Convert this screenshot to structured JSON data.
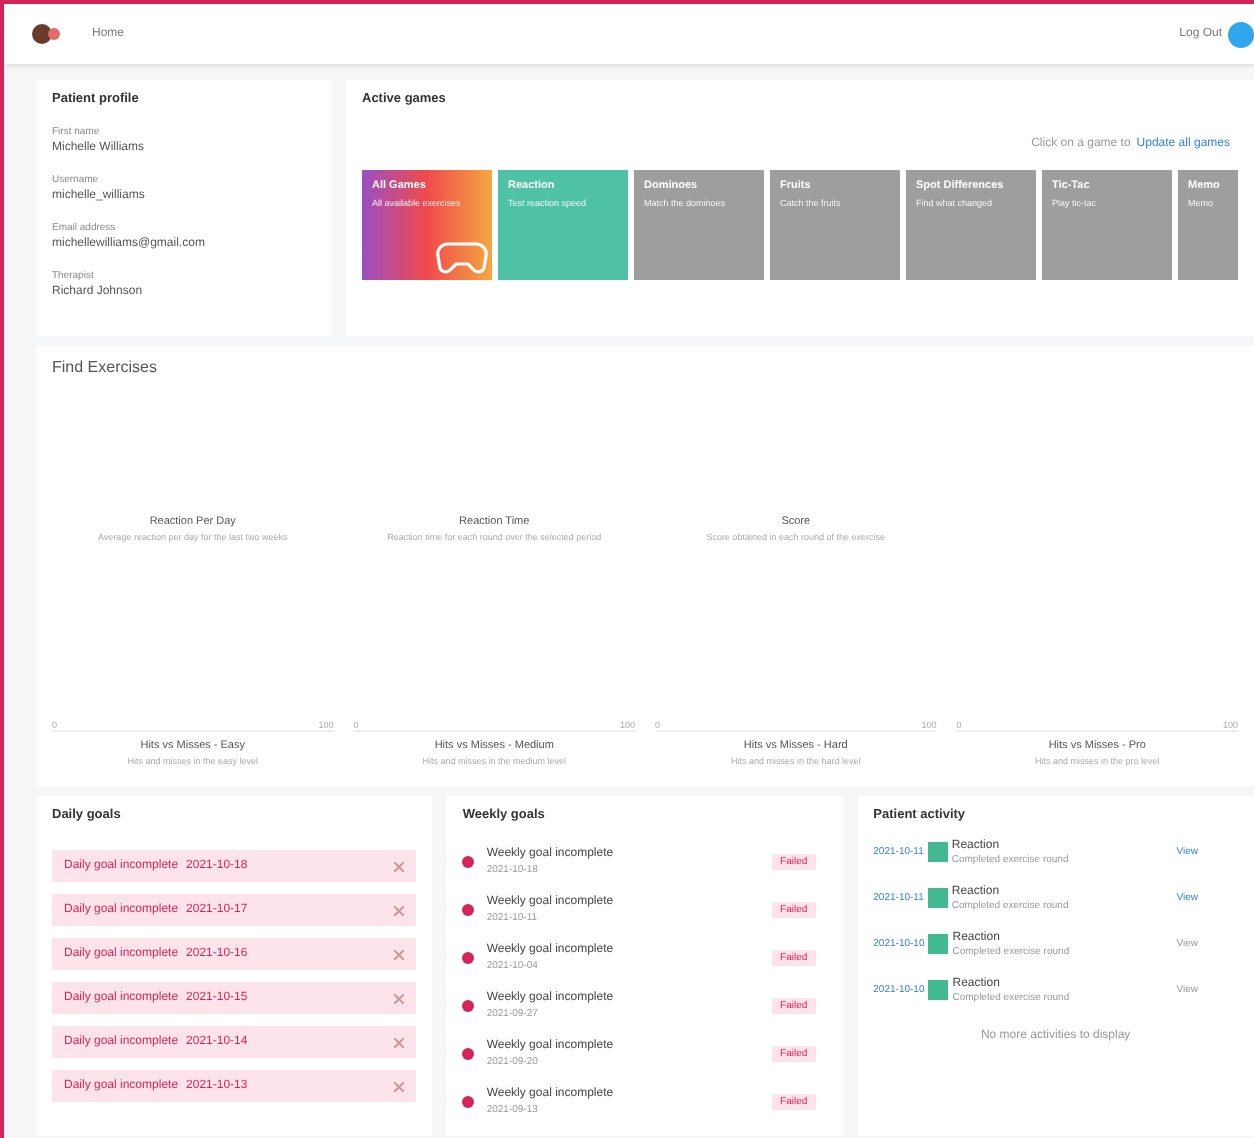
{
  "topbar": {
    "nav_link": "Home",
    "user_name": "Log Out"
  },
  "profile": {
    "title": "Patient profile",
    "fields": [
      {
        "label": "First name",
        "value": "Michelle Williams"
      },
      {
        "label": "Username",
        "value": "michelle_williams"
      },
      {
        "label": "Email address",
        "value": "michellewilliams@gmail.com"
      },
      {
        "label": "Therapist",
        "value": "Richard Johnson"
      }
    ]
  },
  "games": {
    "title": "Active games",
    "hint": "Click on a game to",
    "link": "Update all games",
    "tiles": [
      {
        "title": "All Games",
        "subtitle": "All available exercises",
        "kind": "gradient",
        "color": "#f04a4a"
      },
      {
        "title": "Reaction",
        "subtitle": "Test reaction speed",
        "kind": "solid",
        "color": "#4fc2a6"
      },
      {
        "title": "Dominoes",
        "subtitle": "Match the dominoes",
        "kind": "solid",
        "color": "#9e9e9e"
      },
      {
        "title": "Fruits",
        "subtitle": "Catch the fruits",
        "kind": "solid",
        "color": "#9e9e9e"
      },
      {
        "title": "Spot Differences",
        "subtitle": "Find what changed",
        "kind": "solid",
        "color": "#9e9e9e"
      },
      {
        "title": "Tic-Tac",
        "subtitle": "Play tic-tac",
        "kind": "solid",
        "color": "#9e9e9e"
      },
      {
        "title": "Memo",
        "subtitle": "Memo",
        "kind": "solid",
        "color": "#9e9e9e"
      }
    ]
  },
  "exercises": {
    "title": "Find Exercises",
    "charts": [
      {
        "title": "Reaction Per Day",
        "subtitle": "Average reaction per day for the last two weeks"
      },
      {
        "title": "Reaction Time",
        "subtitle": "Reaction time for each round over the selected period"
      },
      {
        "title": "Score",
        "subtitle": "Score obtained in each round of the exercise"
      }
    ],
    "hit_charts": [
      {
        "title": "Hits vs Misses - Easy",
        "subtitle": "Hits and misses in the easy level",
        "ticks": [
          "0",
          "100"
        ]
      },
      {
        "title": "Hits vs Misses - Medium",
        "subtitle": "Hits and misses in the medium level",
        "ticks": [
          "0",
          "100"
        ]
      },
      {
        "title": "Hits vs Misses - Hard",
        "subtitle": "Hits and misses in the hard level",
        "ticks": [
          "0",
          "100"
        ]
      },
      {
        "title": "Hits vs Misses - Pro",
        "subtitle": "Hits and misses in the pro level",
        "ticks": [
          "0",
          "100"
        ]
      }
    ]
  },
  "daily_goals": {
    "title": "Daily goals",
    "items": [
      {
        "text": "Daily goal incomplete",
        "date": "2021-10-18"
      },
      {
        "text": "Daily goal incomplete",
        "date": "2021-10-17"
      },
      {
        "text": "Daily goal incomplete",
        "date": "2021-10-16"
      },
      {
        "text": "Daily goal incomplete",
        "date": "2021-10-15"
      },
      {
        "text": "Daily goal incomplete",
        "date": "2021-10-14"
      },
      {
        "text": "Daily goal incomplete",
        "date": "2021-10-13"
      }
    ]
  },
  "weekly_goals": {
    "title": "Weekly goals",
    "items": [
      {
        "text": "Weekly goal incomplete",
        "date": "2021-10-18",
        "badge": "Failed"
      },
      {
        "text": "Weekly goal incomplete",
        "date": "2021-10-11",
        "badge": "Failed"
      },
      {
        "text": "Weekly goal incomplete",
        "date": "2021-10-04",
        "badge": "Failed"
      },
      {
        "text": "Weekly goal incomplete",
        "date": "2021-09-27",
        "badge": "Failed"
      },
      {
        "text": "Weekly goal incomplete",
        "date": "2021-09-20",
        "badge": "Failed"
      },
      {
        "text": "Weekly goal incomplete",
        "date": "2021-09-13",
        "badge": "Failed"
      }
    ]
  },
  "activity": {
    "title": "Patient activity",
    "items": [
      {
        "date": "2021-10-11",
        "name": "Reaction",
        "detail": "Completed exercise round",
        "link": "View",
        "linked": true
      },
      {
        "date": "2021-10-11",
        "name": "Reaction",
        "detail": "Completed exercise round",
        "link": "View",
        "linked": true
      },
      {
        "date": "2021-10-10",
        "name": "Reaction",
        "detail": "Completed exercise round",
        "link": "View",
        "linked": false
      },
      {
        "date": "2021-10-10",
        "name": "Reaction",
        "detail": "Completed exercise round",
        "link": "View",
        "linked": false
      }
    ],
    "footer": "No more activities to display"
  }
}
